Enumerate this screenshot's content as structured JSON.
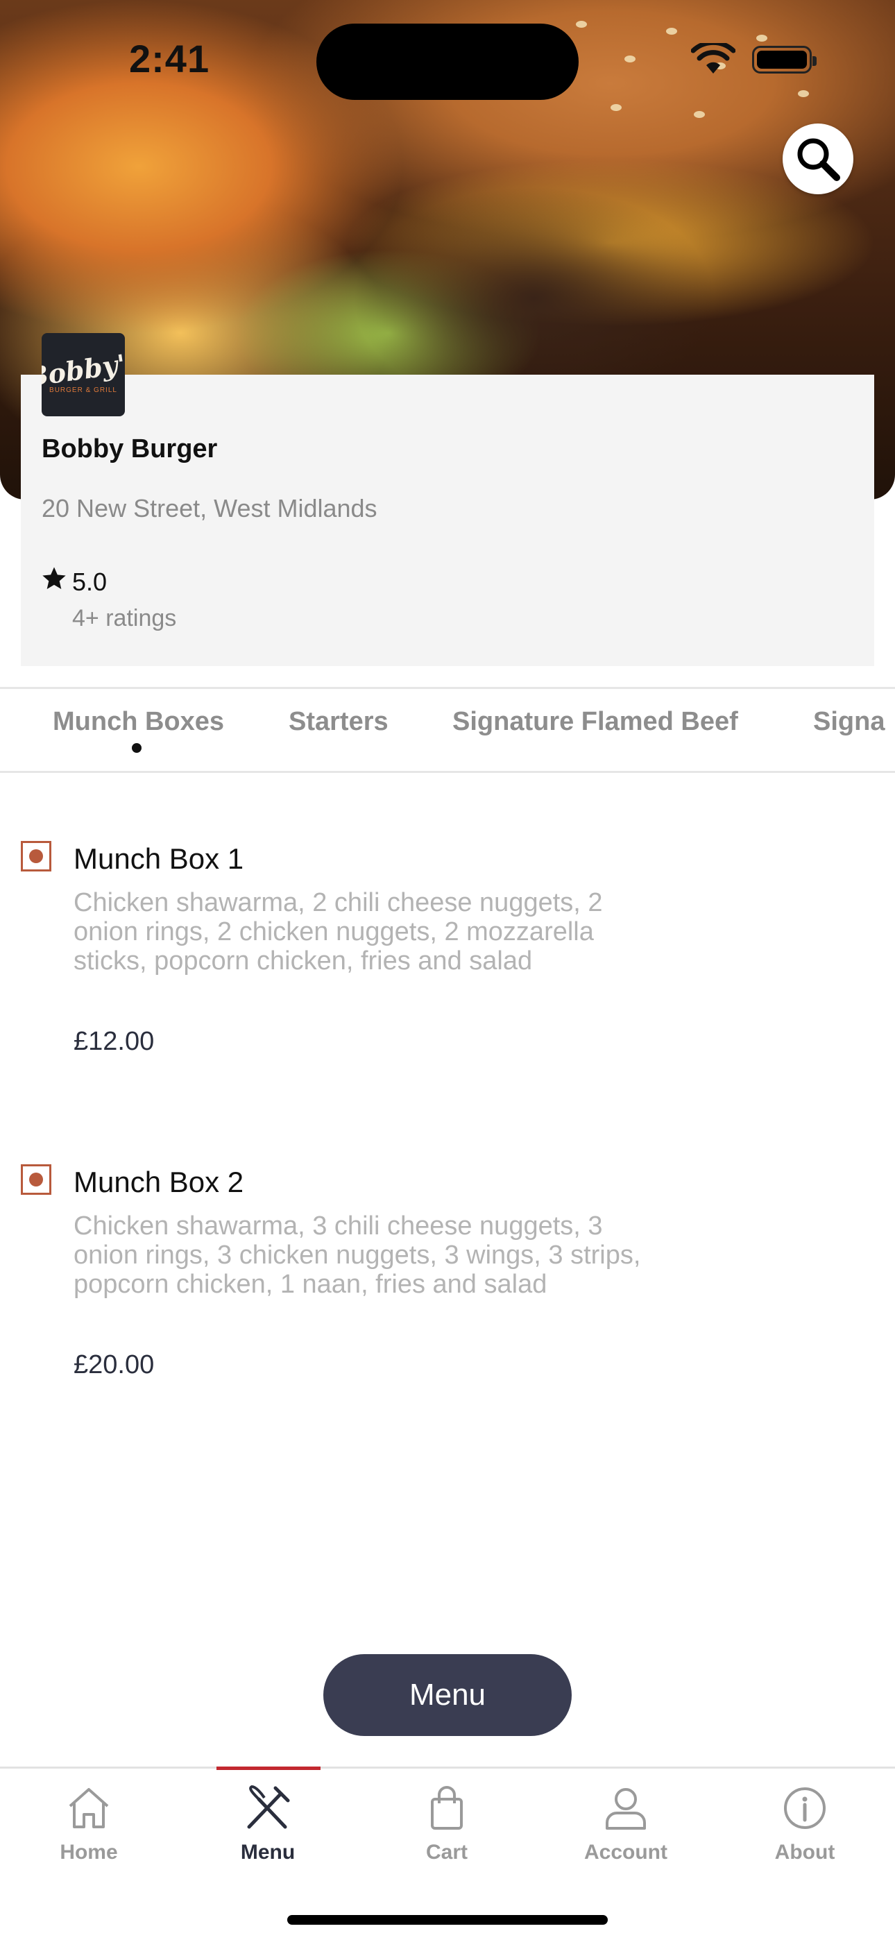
{
  "status_bar": {
    "time": "2:41"
  },
  "restaurant": {
    "logo_text": "Bobby's",
    "logo_subtext": "BURGER & GRILL",
    "name": "Bobby Burger",
    "address": "20 New Street, West Midlands",
    "rating": "5.0",
    "rating_count": "4+ ratings"
  },
  "category_tabs": [
    {
      "label": "Munch Boxes",
      "active": true
    },
    {
      "label": "Starters",
      "active": false
    },
    {
      "label": "Signature Flamed Beef",
      "active": false
    },
    {
      "label": "Signa",
      "active": false
    }
  ],
  "menu_items": [
    {
      "name": "Munch Box 1",
      "description": "Chicken shawarma, 2 chili cheese nuggets, 2 onion rings, 2 chicken nuggets, 2 mozzarella sticks, popcorn chicken, fries and salad",
      "price": "£12.00"
    },
    {
      "name": "Munch Box 2",
      "description": "Chicken shawarma, 3 chili cheese nuggets, 3 onion rings, 3 chicken nuggets, 3 wings, 3 strips, popcorn chicken, 1 naan, fries and salad",
      "price": "£20.00"
    }
  ],
  "menu_button": {
    "label": "Menu"
  },
  "bottom_nav": [
    {
      "label": "Home",
      "icon": "home-icon"
    },
    {
      "label": "Menu",
      "icon": "fork-knife-icon",
      "active": true
    },
    {
      "label": "Cart",
      "icon": "shopping-bag-icon"
    },
    {
      "label": "Account",
      "icon": "user-icon"
    },
    {
      "label": "About",
      "icon": "info-icon"
    }
  ],
  "colors": {
    "accent": "#c2282f",
    "item_icon": "#b85a3c",
    "menu_pill": "#3a3d52",
    "text_muted": "#8a8a8a"
  }
}
